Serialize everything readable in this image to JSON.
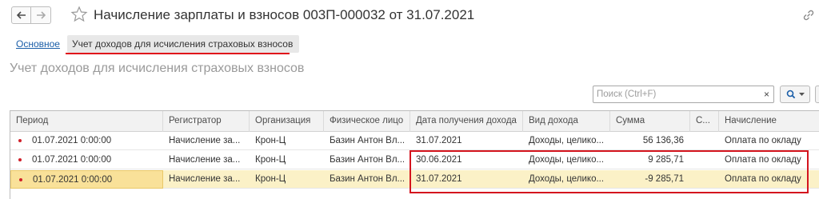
{
  "window": {
    "title": "Начисление зарплаты и взносов 003П-000032 от 31.07.2021"
  },
  "tabs": [
    {
      "label": "Основное"
    },
    {
      "label": "Учет доходов для исчисления страховых взносов"
    }
  ],
  "section": {
    "title": "Учет доходов для исчисления страховых взносов"
  },
  "search": {
    "placeholder": "Поиск (Ctrl+F)",
    "clear_label": "×"
  },
  "table": {
    "columns": [
      "Период",
      "Регистратор",
      "Организация",
      "Физическое лицо",
      "Дата получения дохода",
      "Вид дохода",
      "Сумма",
      "С...",
      "Начисление"
    ],
    "rows": [
      {
        "period": "01.07.2021 0:00:00",
        "registrar": "Начисление за...",
        "org": "Крон-Ц",
        "person": "Базин Антон Вл...",
        "date": "31.07.2021",
        "kind": "Доходы, целико...",
        "sum": "56 136,36",
        "s": "",
        "accrual": "Оплата по окладу"
      },
      {
        "period": "01.07.2021 0:00:00",
        "registrar": "Начисление за...",
        "org": "Крон-Ц",
        "person": "Базин Антон Вл...",
        "date": "30.06.2021",
        "kind": "Доходы, целико...",
        "sum": "9 285,71",
        "s": "",
        "accrual": "Оплата по окладу"
      },
      {
        "period": "01.07.2021 0:00:00",
        "registrar": "Начисление за...",
        "org": "Крон-Ц",
        "person": "Базин Антон Вл...",
        "date": "31.07.2021",
        "kind": "Доходы, целико...",
        "sum": "-9 285,71",
        "s": "",
        "accrual": "Оплата по окладу"
      }
    ]
  },
  "colors": {
    "tab_underline": "#e0101a",
    "highlight_box": "#d4141e",
    "selected_row": "#fbf1c7",
    "link": "#1a5ea8"
  }
}
